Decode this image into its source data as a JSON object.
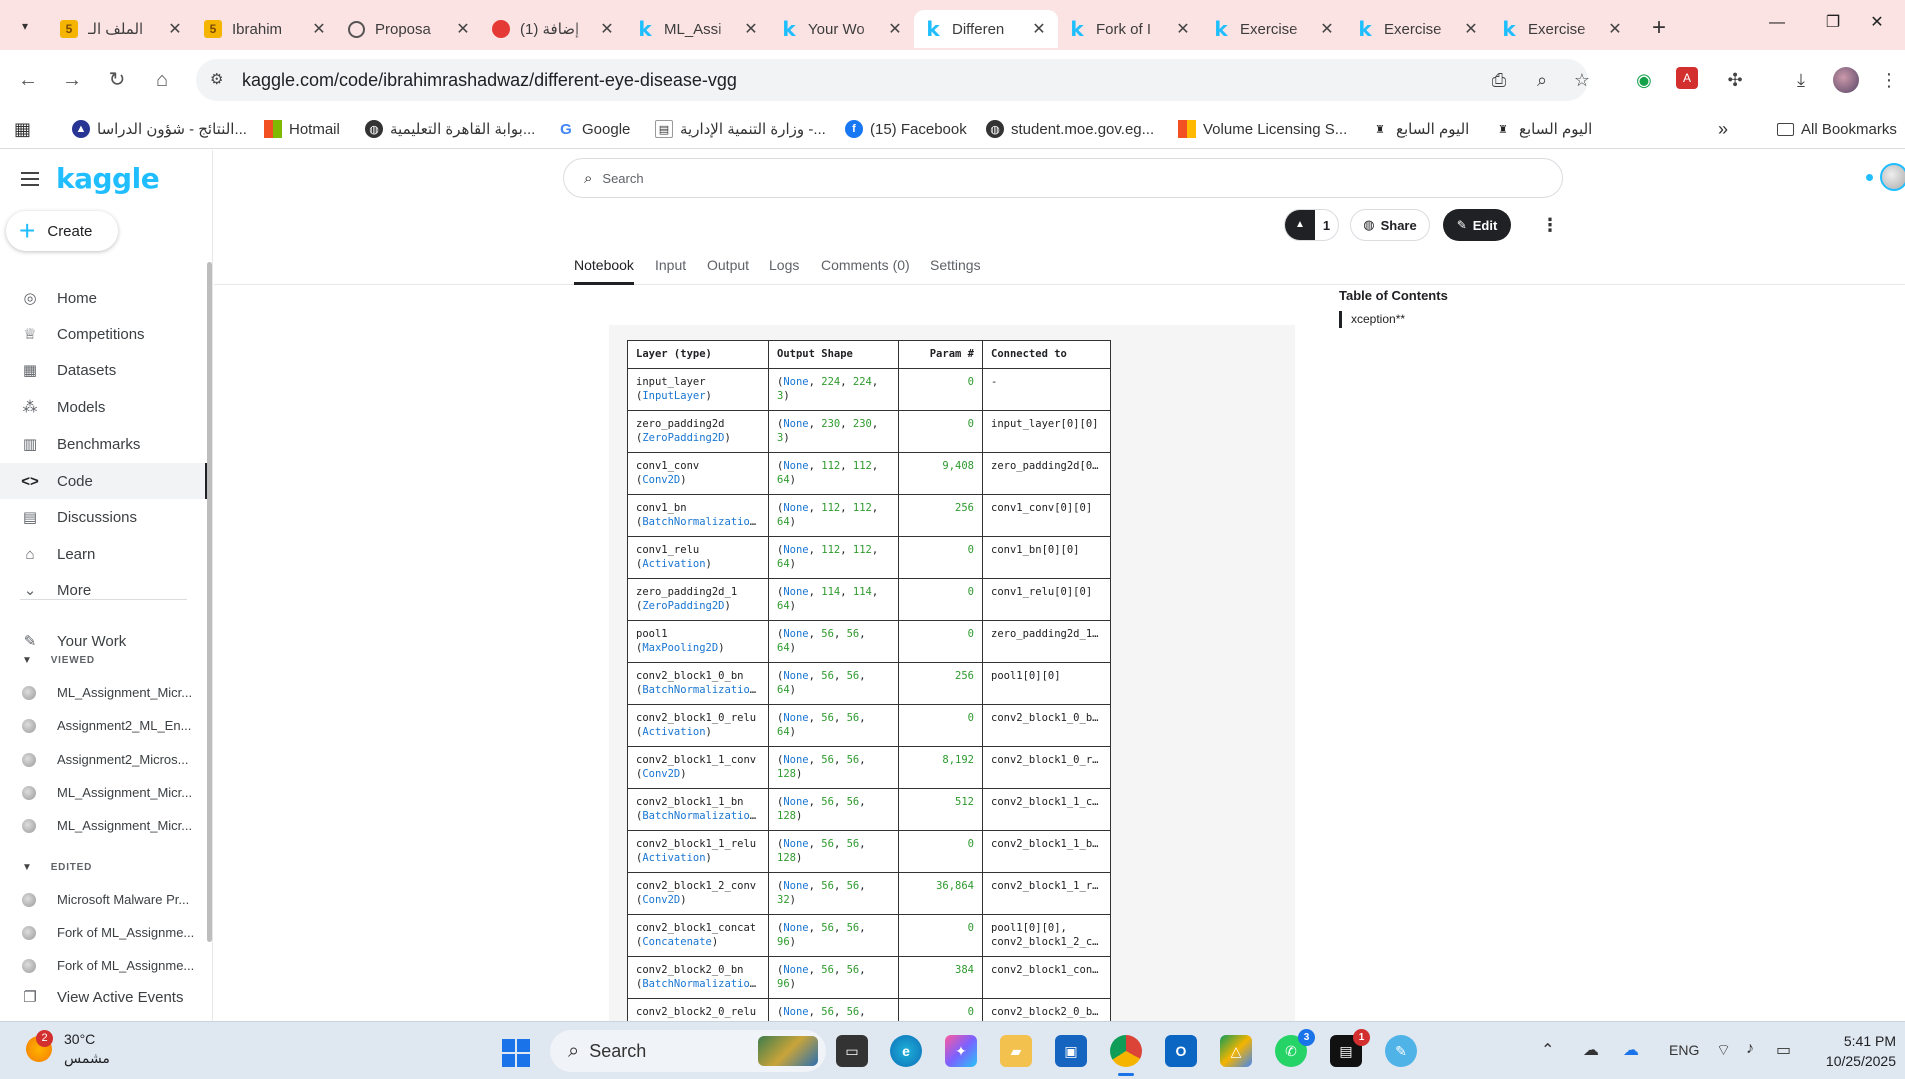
{
  "browser": {
    "tabs": [
      {
        "title": "الملف الـ",
        "icon": "five",
        "active": false
      },
      {
        "title": "Ibrahim",
        "icon": "five",
        "active": false
      },
      {
        "title": "Proposa",
        "icon": "circle",
        "active": false
      },
      {
        "title": "(1) إضافة",
        "icon": "red",
        "active": false
      },
      {
        "title": "ML_Assi",
        "icon": "k",
        "active": false
      },
      {
        "title": "Your Wo",
        "icon": "k",
        "active": false
      },
      {
        "title": "Differen",
        "icon": "k",
        "active": true
      },
      {
        "title": "Fork of I",
        "icon": "k",
        "active": false
      },
      {
        "title": "Exercise",
        "icon": "k",
        "active": false
      },
      {
        "title": "Exercise",
        "icon": "k",
        "active": false
      },
      {
        "title": "Exercise",
        "icon": "k",
        "active": false
      }
    ],
    "url": "kaggle.com/code/ibrahimrashadwaz/different-eye-disease-vgg",
    "bookmarks": [
      {
        "label": "النتائج - شؤون الدراسا..."
      },
      {
        "label": "Hotmail"
      },
      {
        "label": "بوابة القاهرة التعليمية..."
      },
      {
        "label": "Google"
      },
      {
        "label": "وزارة التنمية الإدارية -..."
      },
      {
        "label": "(15) Facebook"
      },
      {
        "label": "student.moe.gov.eg..."
      },
      {
        "label": "Volume Licensing S..."
      },
      {
        "label": "اليوم السابع"
      },
      {
        "label": "اليوم السابع"
      }
    ],
    "all_bookmarks": "All Bookmarks"
  },
  "kaggle": {
    "logo": "kaggle",
    "create": "Create",
    "nav": [
      {
        "label": "Home"
      },
      {
        "label": "Competitions"
      },
      {
        "label": "Datasets"
      },
      {
        "label": "Models"
      },
      {
        "label": "Benchmarks"
      },
      {
        "label": "Code"
      },
      {
        "label": "Discussions"
      },
      {
        "label": "Learn"
      },
      {
        "label": "More"
      }
    ],
    "your_work": "Your Work",
    "viewed_label": "VIEWED",
    "viewed": [
      "ML_Assignment_Micr...",
      "Assignment2_ML_En...",
      "Assignment2_Micros...",
      "ML_Assignment_Micr...",
      "ML_Assignment_Micr..."
    ],
    "edited_label": "EDITED",
    "edited": [
      "Microsoft Malware Pr...",
      "Fork of ML_Assignme...",
      "Fork of ML_Assignme..."
    ],
    "view_active_events": "View Active Events",
    "search_placeholder": "Search",
    "vote_count": "1",
    "share": "Share",
    "edit": "Edit",
    "tabs": [
      "Notebook",
      "Input",
      "Output",
      "Logs",
      "Comments (0)",
      "Settings"
    ],
    "toc_title": "Table of Contents",
    "toc_items": [
      "xception**"
    ]
  },
  "summary_table": {
    "headers": [
      "Layer (type)",
      "Output Shape",
      "Param #",
      "Connected to"
    ],
    "rows": [
      {
        "name": "input_layer",
        "type": "InputLayer",
        "s1": "224",
        "s2": "224",
        "ch": "3",
        "params": "0",
        "conn1": "-",
        "conn2": ""
      },
      {
        "name": "zero_padding2d",
        "type": "ZeroPadding2D",
        "s1": "230",
        "s2": "230",
        "ch": "3",
        "params": "0",
        "conn1": "input_layer[0][0]",
        "conn2": ""
      },
      {
        "name": "conv1_conv",
        "type": "Conv2D",
        "s1": "112",
        "s2": "112",
        "ch": "64",
        "params": "9,408",
        "conn1": "zero_padding2d[0…",
        "conn2": ""
      },
      {
        "name": "conv1_bn",
        "type": "BatchNormalizatio…",
        "s1": "112",
        "s2": "112",
        "ch": "64",
        "params": "256",
        "conn1": "conv1_conv[0][0]",
        "conn2": ""
      },
      {
        "name": "conv1_relu",
        "type": "Activation",
        "s1": "112",
        "s2": "112",
        "ch": "64",
        "params": "0",
        "conn1": "conv1_bn[0][0]",
        "conn2": ""
      },
      {
        "name": "zero_padding2d_1",
        "type": "ZeroPadding2D",
        "s1": "114",
        "s2": "114",
        "ch": "64",
        "params": "0",
        "conn1": "conv1_relu[0][0]",
        "conn2": ""
      },
      {
        "name": "pool1",
        "type": "MaxPooling2D",
        "s1": "56",
        "s2": "56",
        "ch": "64",
        "params": "0",
        "conn1": "zero_padding2d_1…",
        "conn2": ""
      },
      {
        "name": "conv2_block1_0_bn",
        "type": "BatchNormalizatio…",
        "s1": "56",
        "s2": "56",
        "ch": "64",
        "params": "256",
        "conn1": "pool1[0][0]",
        "conn2": ""
      },
      {
        "name": "conv2_block1_0_relu",
        "type": "Activation",
        "s1": "56",
        "s2": "56",
        "ch": "64",
        "params": "0",
        "conn1": "conv2_block1_0_b…",
        "conn2": ""
      },
      {
        "name": "conv2_block1_1_conv",
        "type": "Conv2D",
        "s1": "56",
        "s2": "56",
        "ch": "128",
        "params": "8,192",
        "conn1": "conv2_block1_0_r…",
        "conn2": ""
      },
      {
        "name": "conv2_block1_1_bn",
        "type": "BatchNormalizatio…",
        "s1": "56",
        "s2": "56",
        "ch": "128",
        "params": "512",
        "conn1": "conv2_block1_1_c…",
        "conn2": ""
      },
      {
        "name": "conv2_block1_1_relu",
        "type": "Activation",
        "s1": "56",
        "s2": "56",
        "ch": "128",
        "params": "0",
        "conn1": "conv2_block1_1_b…",
        "conn2": ""
      },
      {
        "name": "conv2_block1_2_conv",
        "type": "Conv2D",
        "s1": "56",
        "s2": "56",
        "ch": "32",
        "params": "36,864",
        "conn1": "conv2_block1_1_r…",
        "conn2": ""
      },
      {
        "name": "conv2_block1_concat",
        "type": "Concatenate",
        "s1": "56",
        "s2": "56",
        "ch": "96",
        "params": "0",
        "conn1": "pool1[0][0],",
        "conn2": "conv2_block1_2_c…"
      },
      {
        "name": "conv2_block2_0_bn",
        "type": "BatchNormalizatio…",
        "s1": "56",
        "s2": "56",
        "ch": "96",
        "params": "384",
        "conn1": "conv2_block1_con…",
        "conn2": ""
      },
      {
        "name": "conv2_block2_0_relu",
        "type": "",
        "s1": "56",
        "s2": "56",
        "ch": "",
        "params": "0",
        "conn1": "conv2_block2_0_b…",
        "conn2": ""
      }
    ]
  },
  "taskbar": {
    "weather_badge": "2",
    "temp": "30°C",
    "condition": "مشمس",
    "search": "Search",
    "lang": "ENG",
    "time": "5:41 PM",
    "date": "10/25/2025",
    "whatsapp_badge": "3",
    "app_badge": "1"
  }
}
